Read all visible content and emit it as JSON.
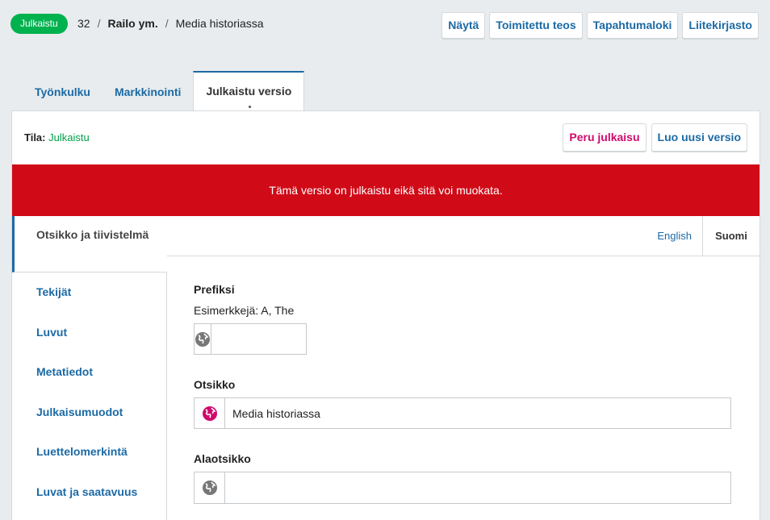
{
  "topbar": {
    "status_badge": "Julkaistu",
    "submission_id": "32",
    "separator": "/",
    "authors": "Railo ym.",
    "title": "Media historiassa",
    "actions": [
      "Näytä",
      "Toimitettu teos",
      "Tapahtumaloki",
      "Liitekirjasto"
    ]
  },
  "tabs": [
    "Työnkulku",
    "Markkinointi",
    "Julkaistu versio"
  ],
  "panel": {
    "status_label": "Tila:",
    "status_value": "Julkaistu",
    "unpublish_button": "Peru julkaisu",
    "new_version_button": "Luo uusi versio",
    "alert": "Tämä versio on julkaistu eikä sitä voi muokata."
  },
  "sidenav": [
    "Otsikko ja tiivistelmä",
    "Tekijät",
    "Luvut",
    "Metatiedot",
    "Julkaisumuodot",
    "Luettelomerkintä",
    "Luvat ja saatavuus"
  ],
  "languages": {
    "english": "English",
    "finnish": "Suomi"
  },
  "form": {
    "prefix_label": "Prefiksi",
    "prefix_description": "Esimerkkejä: A, The",
    "prefix_value": "",
    "title_label": "Otsikko",
    "title_value": "Media historiassa",
    "subtitle_label": "Alaotsikko",
    "subtitle_value": ""
  },
  "colors": {
    "accent": "#1b6aa5",
    "published_green": "#00b24e",
    "alert_red": "#d00a17",
    "danger_pink": "#d00a6c",
    "globe_active": "#d00a6c",
    "globe_inactive": "#777777"
  }
}
